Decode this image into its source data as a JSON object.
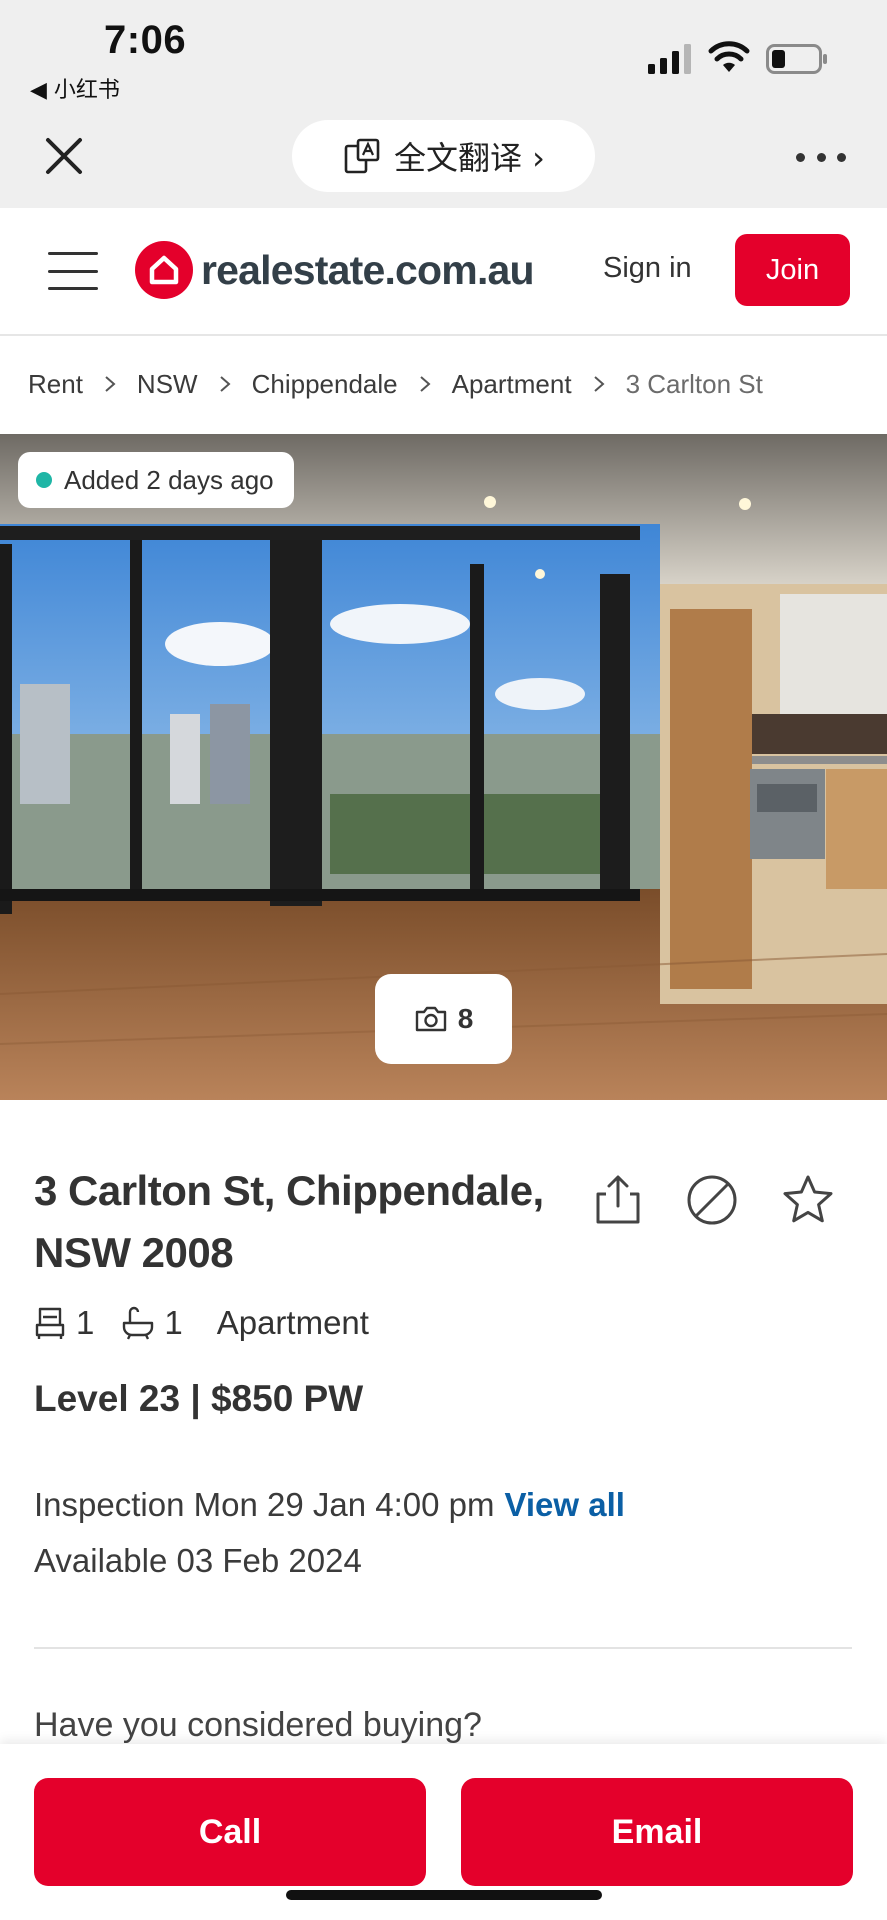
{
  "status_bar": {
    "time": "7:06",
    "back_app": "◀ 小红书"
  },
  "browser": {
    "translate_label": "全文翻译 ›"
  },
  "header": {
    "logo_text": "realestate.com.au",
    "sign_in": "Sign in",
    "join": "Join"
  },
  "breadcrumb": [
    "Rent",
    "NSW",
    "Chippendale",
    "Apartment",
    "3 Carlton St"
  ],
  "hero": {
    "added_badge": "Added 2 days ago",
    "photo_count": "8"
  },
  "listing": {
    "address_line1": "3 Carlton St, Chippendale,",
    "address_line2": "NSW 2008",
    "bedrooms": "1",
    "bathrooms": "1",
    "property_type": "Apartment",
    "price": "Level 23 | $850 PW",
    "inspection": "Inspection Mon 29 Jan 4:00 pm",
    "view_all": "View all",
    "available": "Available 03 Feb 2024",
    "consider_buying": "Have you considered buying?"
  },
  "actions": {
    "call": "Call",
    "email": "Email"
  },
  "colors": {
    "brand": "#e4002b",
    "link": "#0b5fa5",
    "badge_dot": "#1fb6a6"
  }
}
